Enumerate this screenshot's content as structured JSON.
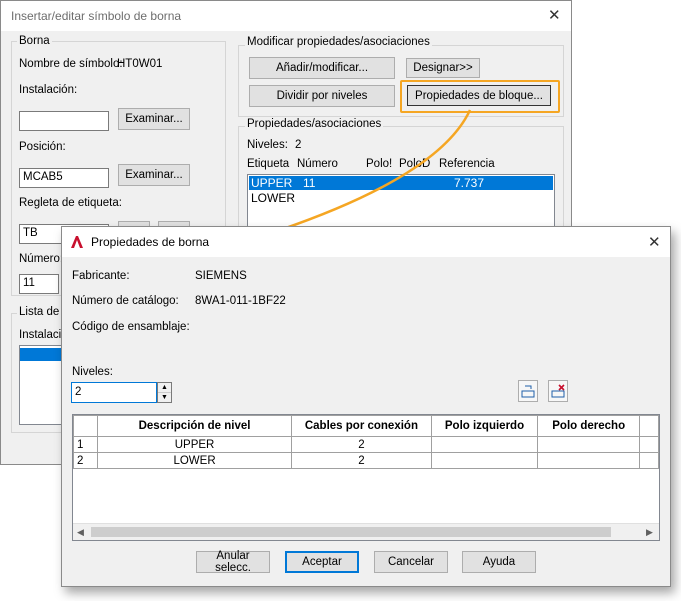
{
  "back_dialog": {
    "title": "Insertar/editar símbolo de borna",
    "borna_group": {
      "label": "Borna",
      "symbol_name_label": "Nombre de símbolo:",
      "symbol_name_value": "HT0W01",
      "installation_label": "Instalación:",
      "installation_value": "",
      "browse_label": "Examinar...",
      "position_label": "Posición:",
      "position_value": "MCAB5",
      "tag_strip_label": "Regleta de etiqueta:",
      "tag_strip_value": "TB",
      "number_label": "Número:",
      "number_value": "11"
    },
    "list_group": {
      "label": "Lista de p",
      "installation_label": "Instalació"
    },
    "modify_group": {
      "label": "Modificar propiedades/asociaciones",
      "add_modify": "Añadir/modificar...",
      "designate": "Designar>>",
      "split_levels": "Dividir por niveles",
      "block_properties": "Propiedades de bloque..."
    },
    "props_group": {
      "label": "Propiedades/asociaciones",
      "levels_label": "Niveles:",
      "levels_value": "2",
      "columns": [
        "Etiqueta",
        "Número",
        "Polo!",
        "PoloD",
        "Referencia"
      ],
      "rows": [
        {
          "tag": "UPPER",
          "number": "11",
          "ref": "7.737"
        },
        {
          "tag": "LOWER",
          "number": "",
          "ref": ""
        }
      ]
    }
  },
  "front_dialog": {
    "title": "Propiedades de borna",
    "manufacturer_label": "Fabricante:",
    "manufacturer_value": "SIEMENS",
    "catalog_label": "Número de catálogo:",
    "catalog_value": "8WA1-011-1BF22",
    "assembly_label": "Código de ensamblaje:",
    "levels_label": "Niveles:",
    "levels_value": "2",
    "table": {
      "headers": [
        "",
        "Descripción de nivel",
        "Cables por conexión",
        "Polo izquierdo",
        "Polo derecho"
      ],
      "rows": [
        [
          "1",
          "UPPER",
          "2",
          "",
          ""
        ],
        [
          "2",
          "LOWER",
          "2",
          "",
          ""
        ]
      ]
    },
    "buttons": {
      "clear": "Anular selecc.",
      "accept": "Aceptar",
      "cancel": "Cancelar",
      "help": "Ayuda"
    }
  },
  "colors": {
    "highlight": "#0078d7",
    "callout": "#f5a623",
    "autocad_red": "#c8102e"
  }
}
